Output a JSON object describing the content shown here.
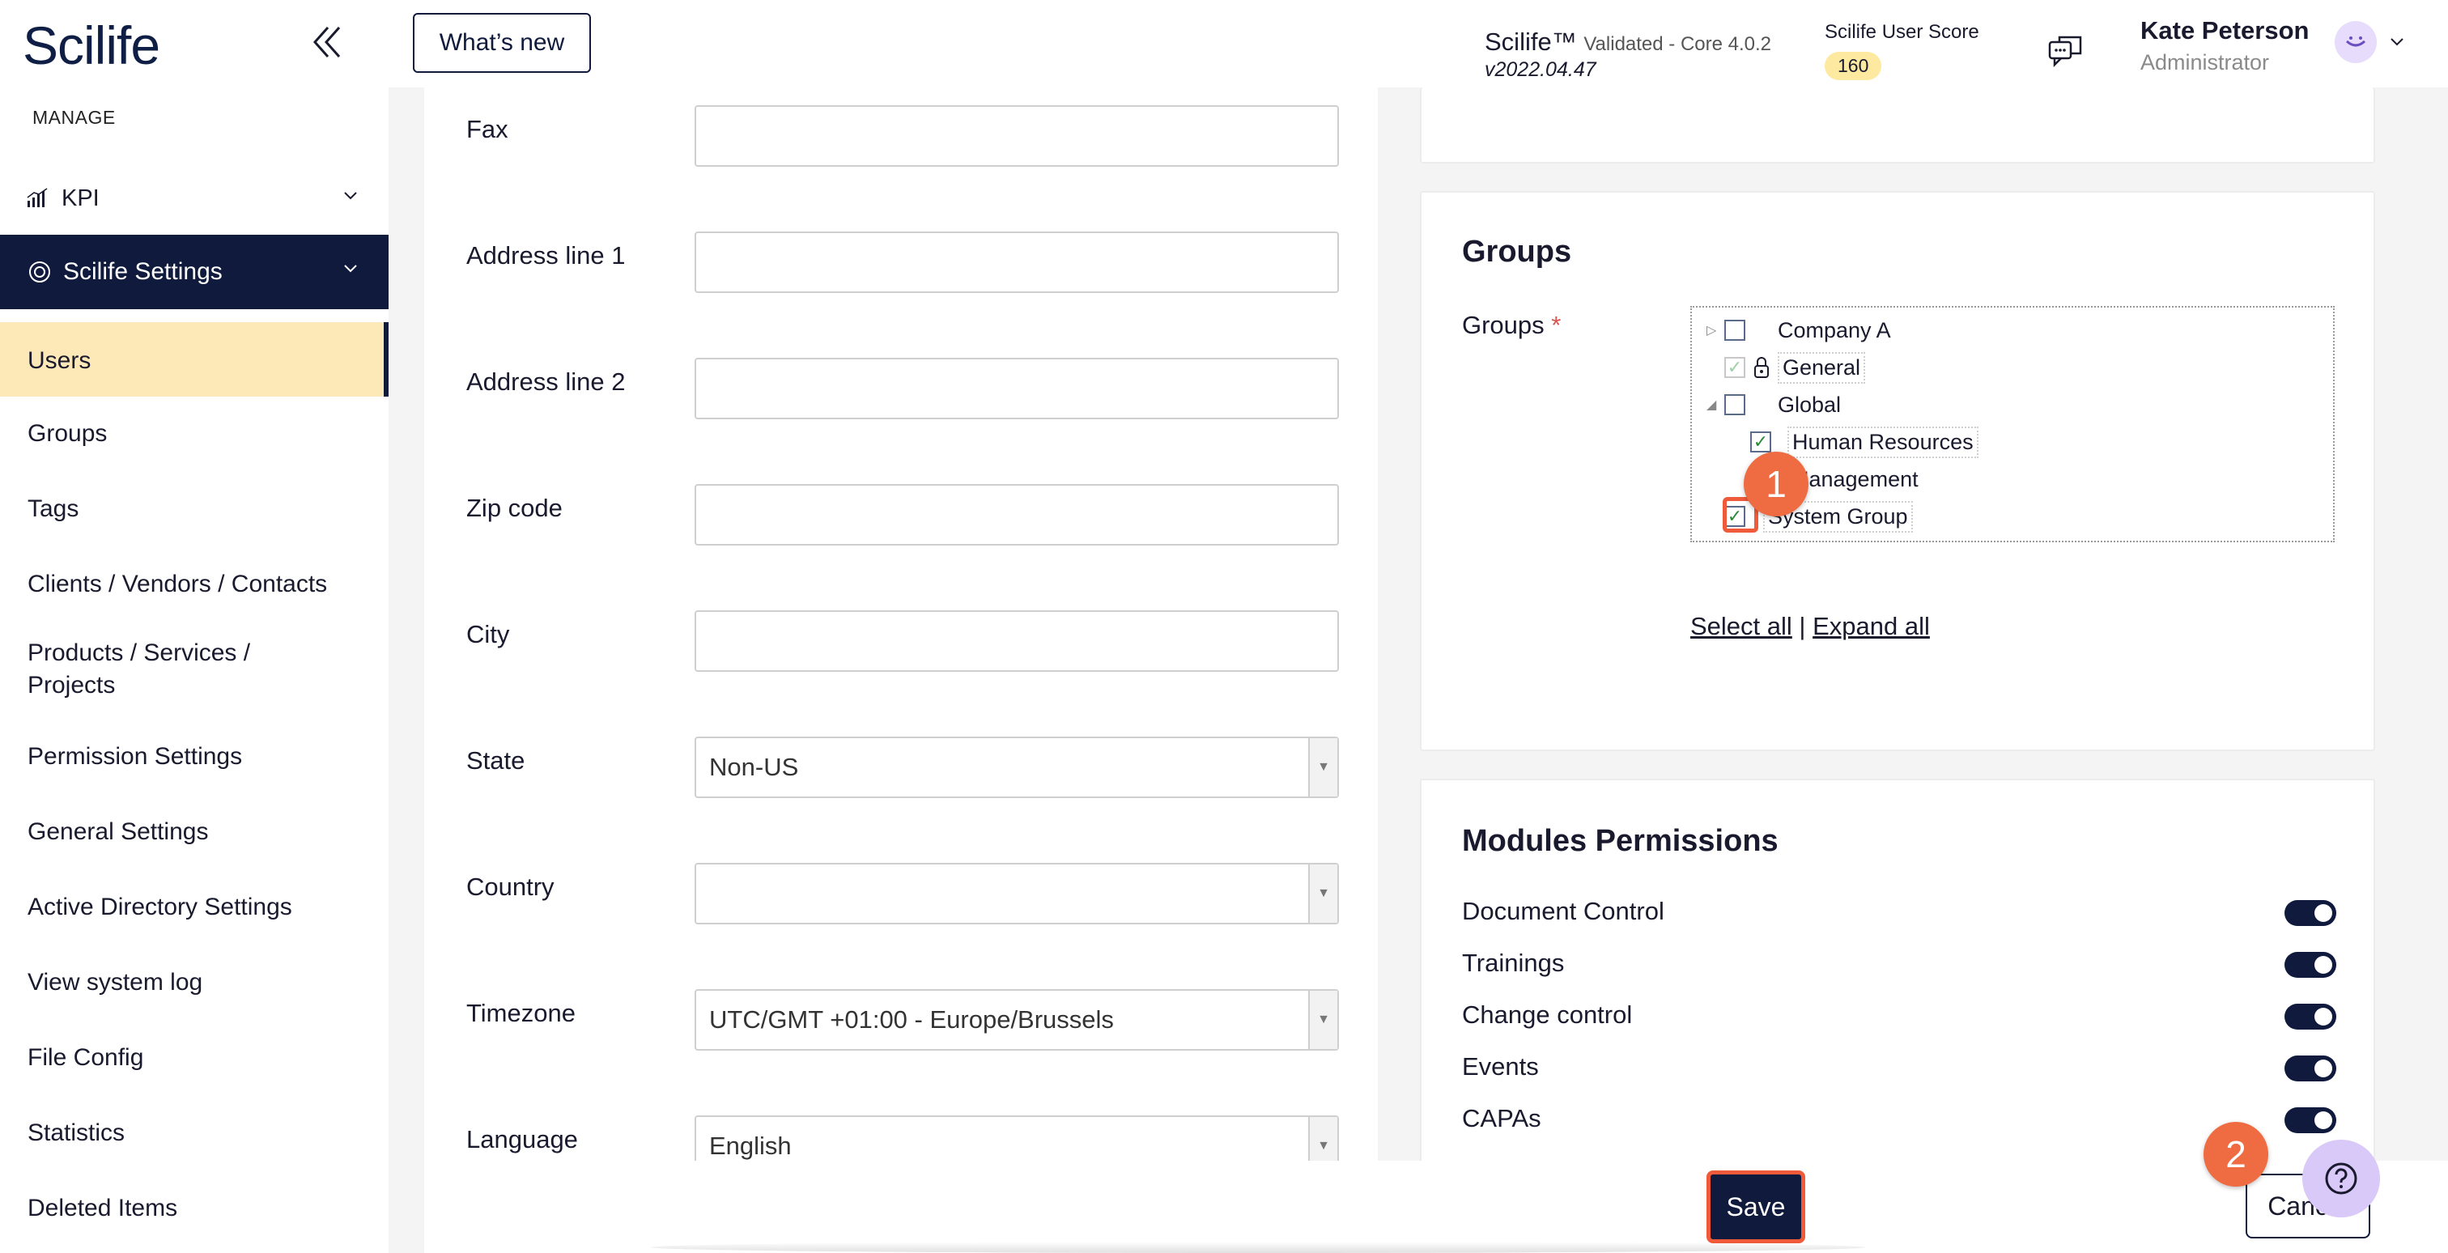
{
  "sidebar": {
    "logo": "Scilife",
    "section_label": "MANAGE",
    "kpi_label": "KPI",
    "settings_label": "Scilife Settings",
    "items": [
      {
        "label": "Users",
        "active": true
      },
      {
        "label": "Groups"
      },
      {
        "label": "Tags"
      },
      {
        "label": "Clients / Vendors / Contacts"
      },
      {
        "label": "Products / Services / Projects"
      },
      {
        "label": "Permission Settings"
      },
      {
        "label": "General Settings"
      },
      {
        "label": "Active Directory Settings"
      },
      {
        "label": "View system log"
      },
      {
        "label": "File Config"
      },
      {
        "label": "Statistics"
      },
      {
        "label": "Deleted Items"
      }
    ]
  },
  "header": {
    "whats_new": "What’s new",
    "product": "Scilife™",
    "validated": "Validated - Core 4.0.2",
    "version": "v2022.04.47",
    "score_label": "Scilife User Score",
    "score_value": "160",
    "user_name": "Kate Peterson",
    "user_role": "Administrator"
  },
  "form": {
    "fax_label": "Fax",
    "fax_value": "",
    "address1_label": "Address line 1",
    "address1_value": "",
    "address2_label": "Address line 2",
    "address2_value": "",
    "zip_label": "Zip code",
    "zip_value": "",
    "city_label": "City",
    "city_value": "",
    "state_label": "State",
    "state_value": "Non-US",
    "country_label": "Country",
    "country_value": "",
    "timezone_label": "Timezone",
    "timezone_value": "UTC/GMT +01:00 - Europe/Brussels",
    "language_label": "Language",
    "language_value": "English"
  },
  "groups": {
    "title": "Groups",
    "field_label": "Groups",
    "required_mark": "*",
    "tree": {
      "company_a": "Company A",
      "general": "General",
      "global": "Global",
      "human_resources": "Human Resources",
      "management": "Management",
      "system_group": "System Group"
    },
    "select_all": "Select all",
    "separator": "|",
    "expand_all": "Expand all"
  },
  "modules": {
    "title": "Modules Permissions",
    "items": [
      {
        "label": "Document Control",
        "enabled": true
      },
      {
        "label": "Trainings",
        "enabled": true
      },
      {
        "label": "Change control",
        "enabled": true
      },
      {
        "label": "Events",
        "enabled": true
      },
      {
        "label": "CAPAs",
        "enabled": true
      }
    ]
  },
  "footer": {
    "save": "Save",
    "cancel": "Cancel"
  },
  "annotations": {
    "step1": "1",
    "step2": "2"
  },
  "colors": {
    "navy": "#0f1a3d",
    "active_highlight": "#fde9b8",
    "annotation_orange": "#ef6b42",
    "score_badge": "#fde9a0"
  }
}
